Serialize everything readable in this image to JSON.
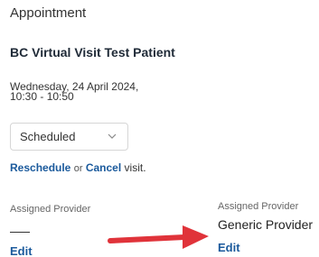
{
  "appointment": {
    "header_title": "Appointment",
    "patient_name": "BC Virtual Visit Test Patient",
    "date_line": "Wednesday, 24 April 2024,",
    "time_line": "10:30 - 10:50"
  },
  "status_select": {
    "value": "Scheduled",
    "chevron_icon": "chevron-down-icon"
  },
  "actions": {
    "reschedule_label": "Reschedule",
    "or_text": "or",
    "cancel_label": "Cancel",
    "suffix_text": "visit."
  },
  "provider_left": {
    "label": "Assigned Provider",
    "value_placeholder": "—",
    "edit_label": "Edit"
  },
  "provider_right": {
    "label": "Assigned Provider",
    "value": "Generic Provider",
    "edit_label": "Edit"
  },
  "colors": {
    "link": "#1b5a9c",
    "annotation_arrow": "#e0333a"
  }
}
